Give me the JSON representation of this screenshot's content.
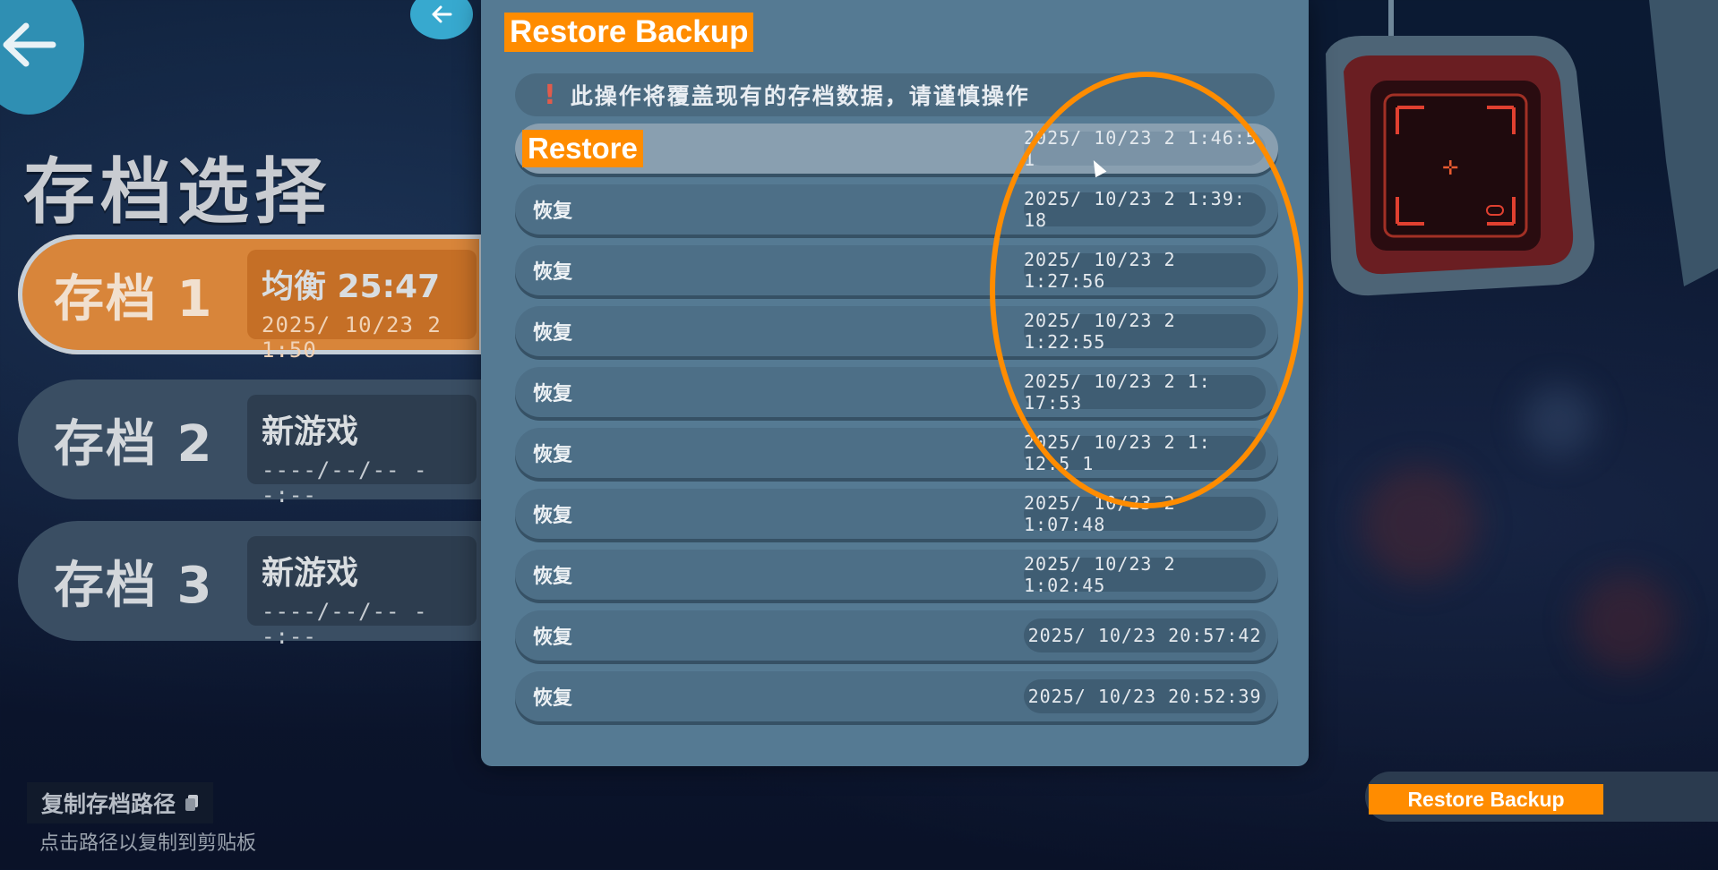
{
  "page": {
    "title": "存档选择",
    "copy_path_label": "复制存档路径",
    "copy_path_hint": "点击路径以复制到剪贴板"
  },
  "save_slots": [
    {
      "name": "存档 1",
      "mode": "均衡 25:47",
      "date": "2025/ 10/23 2 1:50",
      "active": true
    },
    {
      "name": "存档 2",
      "mode": "新游戏",
      "date": "----/--/--  --:--",
      "active": false
    },
    {
      "name": "存档 3",
      "mode": "新游戏",
      "date": "----/--/--  --:--",
      "active": false
    }
  ],
  "dialog": {
    "heading": "Restore Backup",
    "warning": "此操作将覆盖现有的存档数据，请谨慎操作",
    "rows": [
      {
        "label": "Restore",
        "time": "2025/ 10/23 2 1:46:5 1"
      },
      {
        "label": "恢复",
        "time": "2025/ 10/23 2 1:39: 18"
      },
      {
        "label": "恢复",
        "time": "2025/ 10/23 2 1:27:56"
      },
      {
        "label": "恢复",
        "time": "2025/ 10/23 2 1:22:55"
      },
      {
        "label": "恢复",
        "time": "2025/ 10/23 2 1: 17:53"
      },
      {
        "label": "恢复",
        "time": "2025/ 10/23 2 1: 12:5 1"
      },
      {
        "label": "恢复",
        "time": "2025/ 10/23 2 1:07:48"
      },
      {
        "label": "恢复",
        "time": "2025/ 10/23 2 1:02:45"
      },
      {
        "label": "恢复",
        "time": "2025/ 10/23 20:57:42"
      },
      {
        "label": "恢复",
        "time": "2025/ 10/23 20:52:39"
      }
    ]
  },
  "restore_backup_button": "Restore Backup",
  "icons": {
    "back": "arrow-left-icon",
    "warning": "exclamation-icon",
    "copy": "copy-icon"
  },
  "colors": {
    "accent": "#ff8c00",
    "active_slot": "#d8853a",
    "modal_bg": "#557a93",
    "warning": "#e15b4b"
  }
}
